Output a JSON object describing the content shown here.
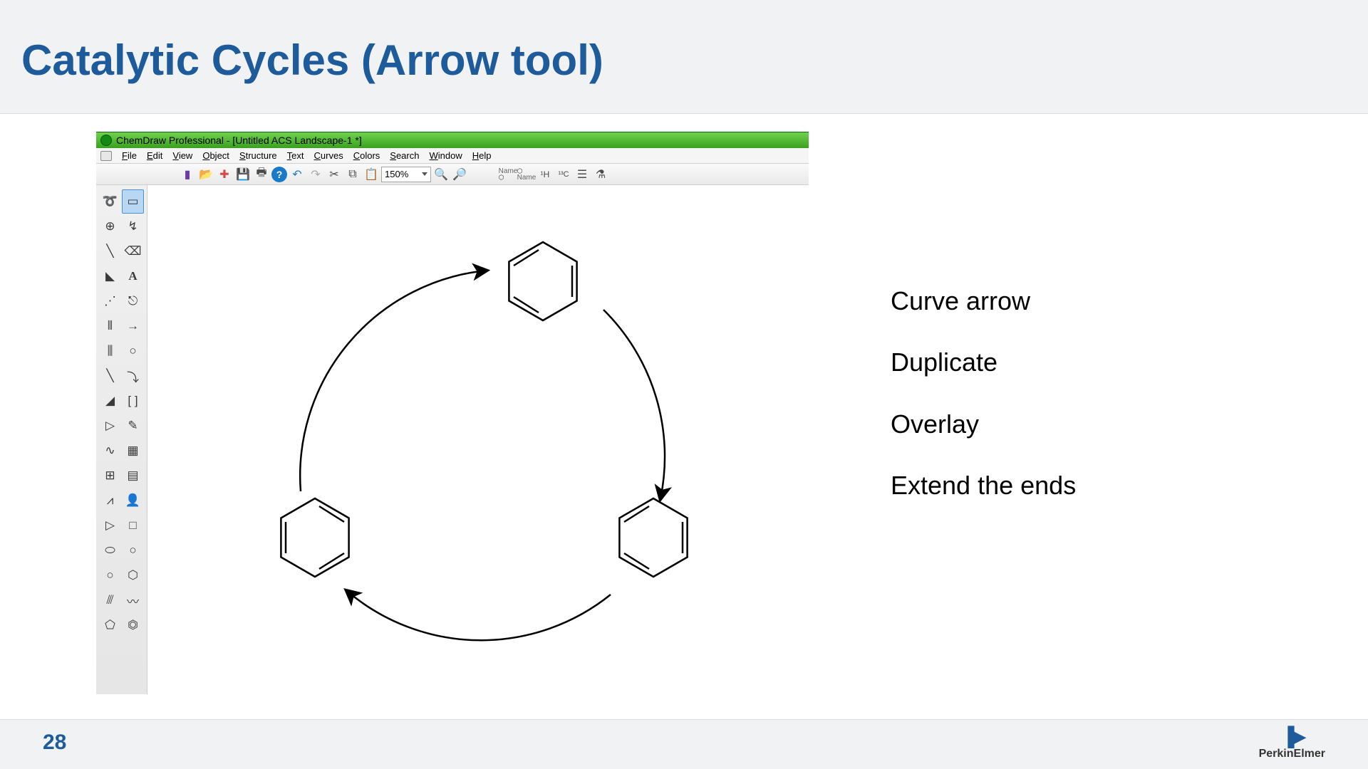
{
  "slide": {
    "title": "Catalytic Cycles (Arrow tool)",
    "page_number": "28",
    "brand": "PerkinElmer"
  },
  "app": {
    "titlebar": "ChemDraw Professional - [Untitled ACS Landscape-1 *]",
    "menus": [
      "File",
      "Edit",
      "View",
      "Object",
      "Structure",
      "Text",
      "Curves",
      "Colors",
      "Search",
      "Window",
      "Help"
    ],
    "toolbar": {
      "zoom_value": "150%",
      "name_label": "Name",
      "name_sub": "Name",
      "h1": "¹H",
      "c13": "¹³C"
    },
    "palette_tools": [
      {
        "name": "lasso-tool",
        "glyph": "➰"
      },
      {
        "name": "marquee-tool",
        "glyph": "▭"
      },
      {
        "name": "structure-perspective-tool",
        "glyph": "⊕"
      },
      {
        "name": "fragment-tool",
        "glyph": "↯"
      },
      {
        "name": "solid-bond-tool",
        "glyph": "╲"
      },
      {
        "name": "eraser-tool",
        "glyph": "⌫"
      },
      {
        "name": "wedge-bond-tool",
        "glyph": "◣"
      },
      {
        "name": "text-tool",
        "glyph": "A"
      },
      {
        "name": "dashed-bond-tool",
        "glyph": "⋰"
      },
      {
        "name": "chain-tool",
        "glyph": "⎋"
      },
      {
        "name": "hash-bond-tool",
        "glyph": "⫴"
      },
      {
        "name": "arrow-tool",
        "glyph": "→"
      },
      {
        "name": "wavy-bond-tool",
        "glyph": "⫼"
      },
      {
        "name": "orbital-tool",
        "glyph": "○"
      },
      {
        "name": "bold-bond-tool",
        "glyph": "╲"
      },
      {
        "name": "curve-tool",
        "glyph": "⤵"
      },
      {
        "name": "half-wedge-tool",
        "glyph": "◢"
      },
      {
        "name": "brackets-tool",
        "glyph": "[ ]"
      },
      {
        "name": "dative-tool",
        "glyph": "▷"
      },
      {
        "name": "pen-tool",
        "glyph": "✎"
      },
      {
        "name": "squiggle-tool",
        "glyph": "∿"
      },
      {
        "name": "template-tool",
        "glyph": "▦"
      },
      {
        "name": "table-tool",
        "glyph": "⊞"
      },
      {
        "name": "grid-tool",
        "glyph": "▤"
      },
      {
        "name": "acyclic-tool",
        "glyph": "⩘"
      },
      {
        "name": "stamp-tool",
        "glyph": "👤"
      },
      {
        "name": "play-tool",
        "glyph": "▷"
      },
      {
        "name": "box-tool",
        "glyph": "□"
      },
      {
        "name": "rounded-box-tool",
        "glyph": "⬭"
      },
      {
        "name": "oval-tool",
        "glyph": "○"
      },
      {
        "name": "circle-tool",
        "glyph": "○"
      },
      {
        "name": "hexagon-tool",
        "glyph": "⬡"
      },
      {
        "name": "chain2-tool",
        "glyph": "⫻"
      },
      {
        "name": "wave-tool",
        "glyph": "〰"
      },
      {
        "name": "pentagon-tool",
        "glyph": "⬠"
      },
      {
        "name": "benzene-tool",
        "glyph": "⏣"
      }
    ]
  },
  "steps": {
    "s1": "Curve arrow",
    "s2": "Duplicate",
    "s3": "Overlay",
    "s4": "Extend the ends"
  }
}
